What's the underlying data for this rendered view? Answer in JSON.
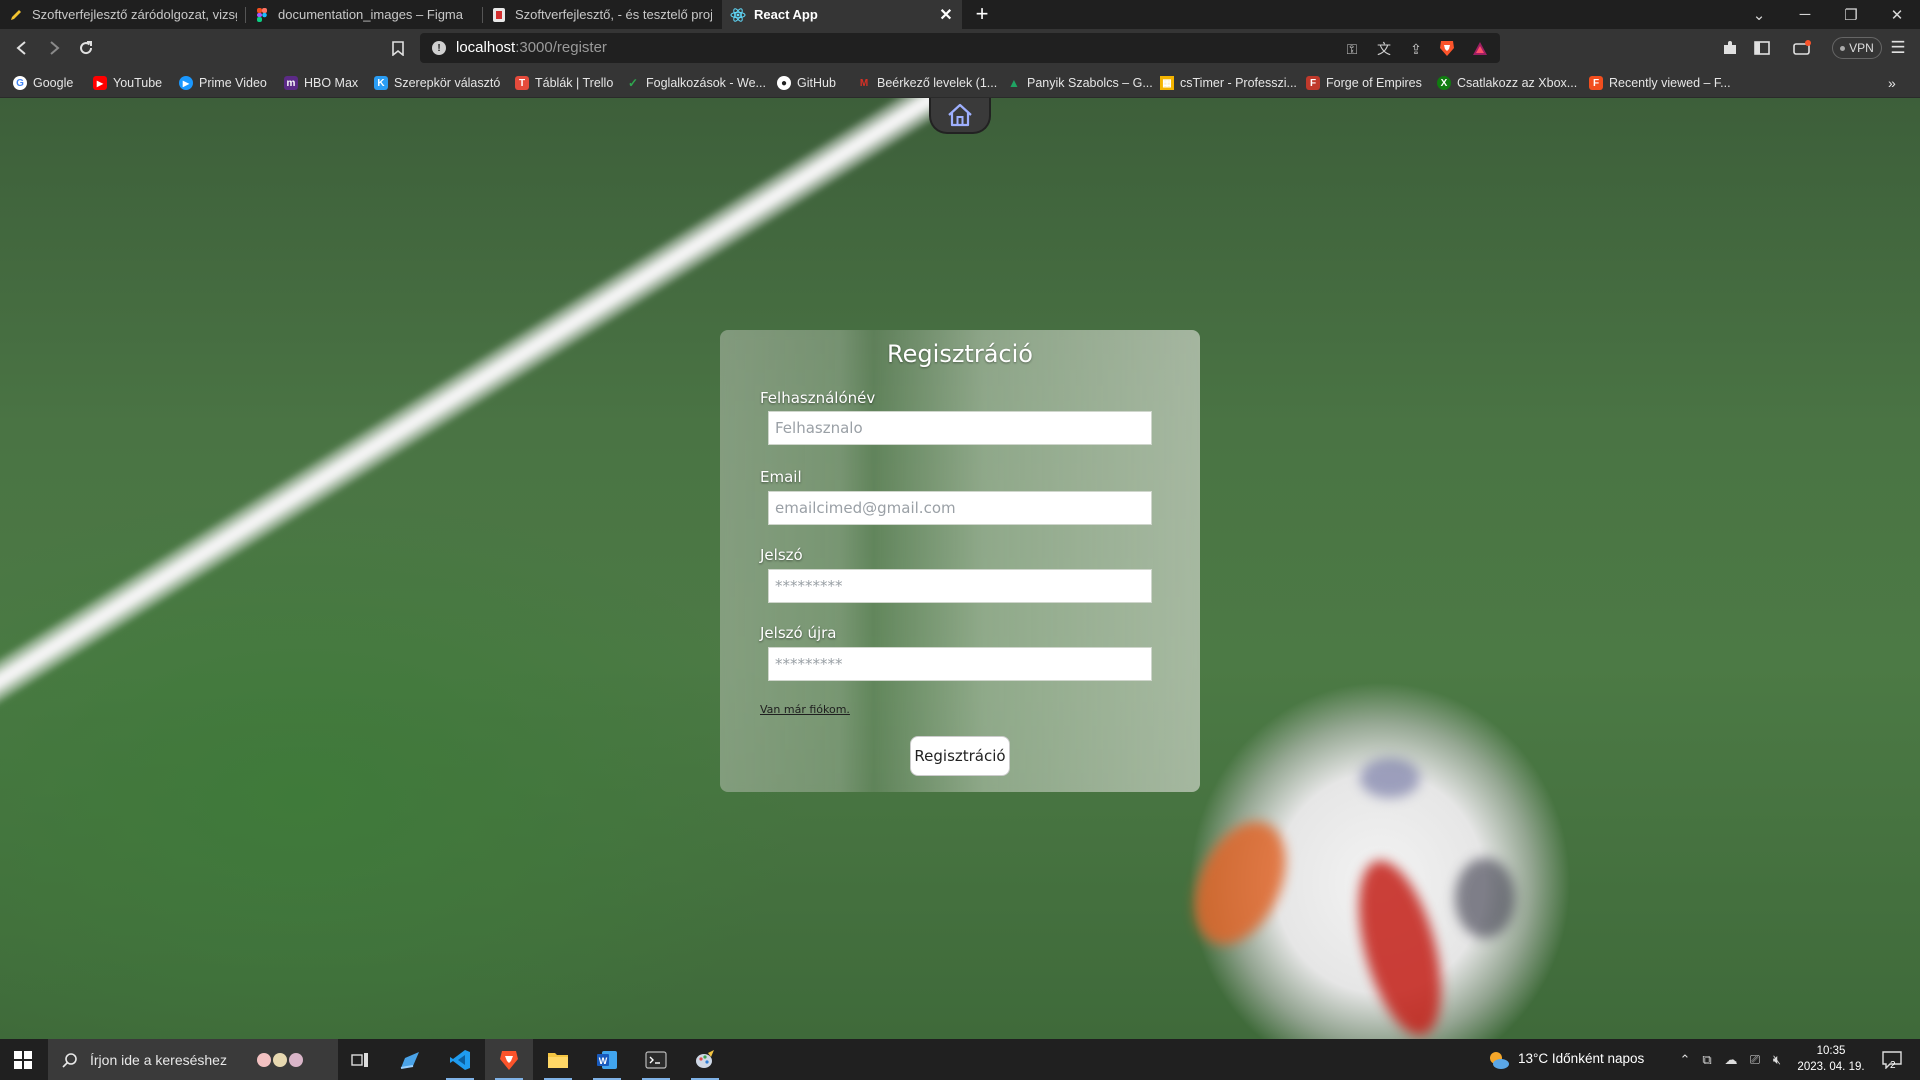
{
  "browser": {
    "tabs": [
      {
        "label": "Szoftverfejlesztő záródolgozat, vizsgaremek",
        "icon": "pencil-icon"
      },
      {
        "label": "documentation_images – Figma",
        "icon": "figma-icon"
      },
      {
        "label": "Szoftverfejlesztő, - és tesztelő projekt",
        "icon": "document-icon"
      },
      {
        "label": "React App",
        "icon": "react-icon"
      }
    ],
    "address": {
      "host": "localhost",
      "path": ":3000/register"
    },
    "vpn_label": "VPN",
    "bookmarks": [
      {
        "label": "Google",
        "icon": "google-icon",
        "color": "#ffffff"
      },
      {
        "label": "YouTube",
        "icon": "youtube-icon",
        "color": "#ff0000"
      },
      {
        "label": "Prime Video",
        "icon": "prime-video-icon",
        "color": "#1a98ff"
      },
      {
        "label": "HBO Max",
        "icon": "hbo-max-icon",
        "color": "#5b2a86"
      },
      {
        "label": "Szerepkör választó",
        "icon": "k-icon",
        "color": "#2a9df4"
      },
      {
        "label": "Táblák | Trello",
        "icon": "trello-icon",
        "color": "#e54b3c"
      },
      {
        "label": "Foglalkozások - We...",
        "icon": "check-icon",
        "color": "#2fa84f"
      },
      {
        "label": "GitHub",
        "icon": "github-icon",
        "color": "#ffffff"
      },
      {
        "label": "Beérkező levelek (1...",
        "icon": "gmail-icon",
        "color": "#d93025"
      },
      {
        "label": "Panyik Szabolcs – G...",
        "icon": "drive-icon",
        "color": "#1fa463"
      },
      {
        "label": "csTimer - Professzi...",
        "icon": "cstimer-icon",
        "color": "#f4b400"
      },
      {
        "label": "Forge of Empires",
        "icon": "forge-icon",
        "color": "#c0392b"
      },
      {
        "label": "Csatlakozz az Xbox...",
        "icon": "xbox-icon",
        "color": "#107c10"
      },
      {
        "label": "Recently viewed – F...",
        "icon": "figma-icon",
        "color": "#f24e1e"
      }
    ]
  },
  "page": {
    "title": "Regisztráció",
    "fields": [
      {
        "label": "Felhasználónév",
        "placeholder": "Felhasznalo"
      },
      {
        "label": "Email",
        "placeholder": "emailcimed@gmail.com"
      },
      {
        "label": "Jelszó",
        "placeholder": "*********"
      },
      {
        "label": "Jelszó újra",
        "placeholder": "*********"
      }
    ],
    "login_link": "Van már fiókom.",
    "submit_label": "Regisztráció"
  },
  "taskbar": {
    "search_placeholder": "Írjon ide a kereséshez",
    "weather": "13°C  Időnként napos",
    "time": "10:35",
    "date": "2023. 04. 19.",
    "notification_count": "2"
  },
  "colors": {
    "accent": "#7fb2e6",
    "card_text": "#ffffff",
    "grass": "#4a7444"
  }
}
